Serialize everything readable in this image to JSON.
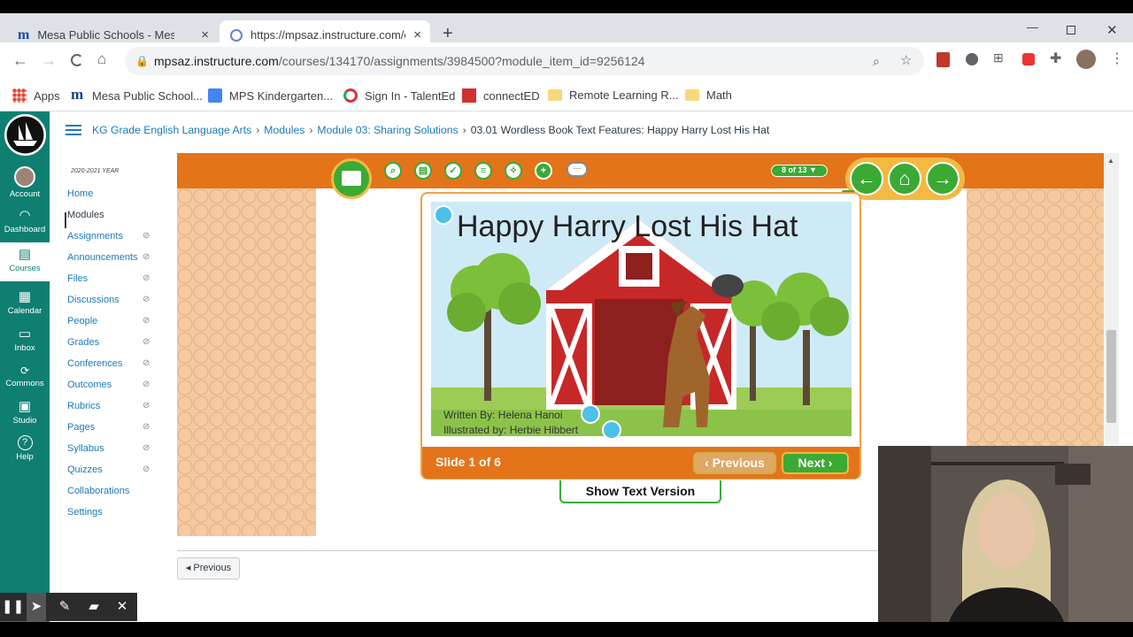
{
  "browser": {
    "tabs": [
      {
        "title": "Mesa Public Schools - Mesa, Ariz",
        "close": "×"
      },
      {
        "title": "https://mpsaz.instructure.com/co",
        "close": "×"
      }
    ],
    "new_tab": "+",
    "address": {
      "domain": "mpsaz.instructure.com",
      "path": "/courses/134170/assignments/3984500?module_item_id=9256124"
    },
    "bookmarks": [
      {
        "label": "Apps",
        "icon": "apps-grid-icon"
      },
      {
        "label": "Mesa Public School...",
        "icon": "mps-logo-icon"
      },
      {
        "label": "MPS Kindergarten...",
        "icon": "docs-icon"
      },
      {
        "label": "Sign In - TalentEd",
        "icon": "talented-icon"
      },
      {
        "label": "connectED",
        "icon": "connected-icon"
      },
      {
        "label": "Remote Learning R...",
        "icon": "folder-icon"
      },
      {
        "label": "Math",
        "icon": "folder-icon"
      }
    ]
  },
  "global_nav": [
    {
      "label": "Account",
      "icon": "avatar"
    },
    {
      "label": "Dashboard",
      "icon": "dashboard-icon"
    },
    {
      "label": "Courses",
      "icon": "courses-icon"
    },
    {
      "label": "Calendar",
      "icon": "calendar-icon"
    },
    {
      "label": "Inbox",
      "icon": "inbox-icon"
    },
    {
      "label": "Commons",
      "icon": "commons-icon"
    },
    {
      "label": "Studio",
      "icon": "studio-icon"
    },
    {
      "label": "Help",
      "icon": "help-icon"
    }
  ],
  "breadcrumb": {
    "items": [
      "KG Grade English Language Arts",
      "Modules",
      "Module 03: Sharing Solutions"
    ],
    "current": "03.01 Wordless Book Text Features: Happy Harry Lost His Hat",
    "sep": "›"
  },
  "course_nav": {
    "year": "2020-2021 YEAR",
    "items": [
      "Home",
      "Modules",
      "Assignments",
      "Announcements",
      "Files",
      "Discussions",
      "People",
      "Grades",
      "Conferences",
      "Outcomes",
      "Rubrics",
      "Pages",
      "Syllabus",
      "Quizzes",
      "Collaborations",
      "Settings"
    ],
    "active": "Modules"
  },
  "player": {
    "page_indicator": "8 of 13 ▼",
    "slide_title": "Happy Harry Lost His Hat",
    "written_by": "Written By: Helena Hanoi",
    "illustrated_by": "Illustrated by: Herbie Hibbert",
    "slide_count": "Slide 1 of 6",
    "previous": "‹ Previous",
    "next": "Next ›",
    "show_text": "Show Text Version"
  },
  "footer_prev": "◂ Previous",
  "annotation_toolbar": [
    "pause-icon",
    "pointer-icon",
    "pen-icon",
    "eraser-icon",
    "close-icon"
  ]
}
